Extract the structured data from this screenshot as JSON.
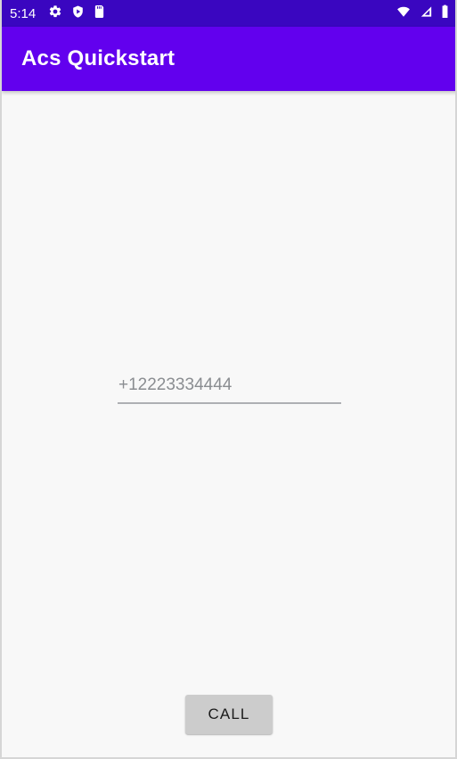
{
  "status_bar": {
    "time": "5:14",
    "left_icons": [
      {
        "name": "settings-gear-icon"
      },
      {
        "name": "shield-play-protect-icon"
      },
      {
        "name": "sd-card-icon"
      }
    ],
    "right_icons": [
      {
        "name": "wifi-icon"
      },
      {
        "name": "cellular-signal-icon"
      },
      {
        "name": "battery-full-icon"
      }
    ],
    "background_color": "#3a06c0",
    "foreground_color": "#ffffff"
  },
  "app_bar": {
    "title": "Acs Quickstart",
    "background_color": "#6200ee",
    "title_color": "#ffffff"
  },
  "main": {
    "phone_input": {
      "value": "",
      "placeholder": "+12223334444",
      "text_color": "#8a8d91",
      "underline_color": "#aeb0b3"
    },
    "call_button": {
      "label": "CALL",
      "background_color": "#cccccc",
      "text_color": "#1a1a1a"
    },
    "background_color": "#f8f8f8"
  }
}
